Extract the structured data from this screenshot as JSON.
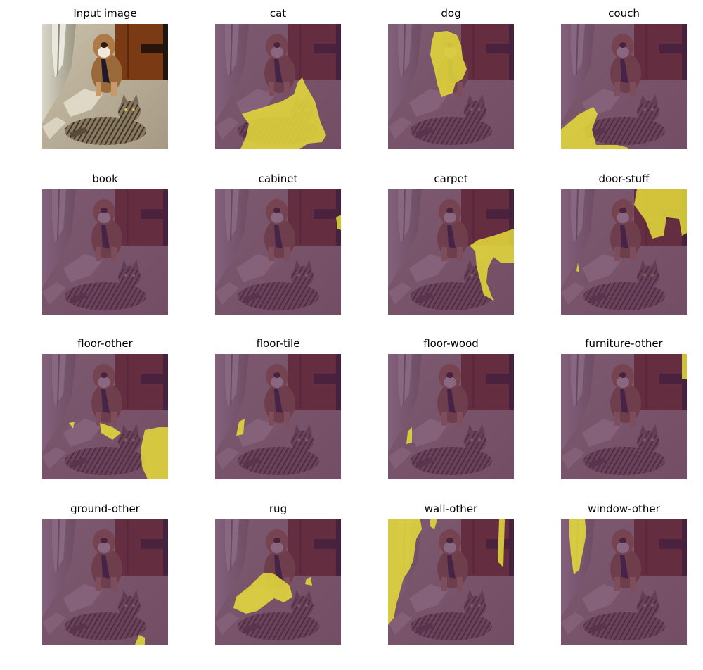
{
  "figure": {
    "panels": [
      {
        "title": "Input image",
        "overlay": false,
        "mask": "none"
      },
      {
        "title": "cat",
        "overlay": true,
        "mask": "cat"
      },
      {
        "title": "dog",
        "overlay": true,
        "mask": "dog"
      },
      {
        "title": "couch",
        "overlay": true,
        "mask": "couch"
      },
      {
        "title": "book",
        "overlay": true,
        "mask": "none"
      },
      {
        "title": "cabinet",
        "overlay": true,
        "mask": "cabinet"
      },
      {
        "title": "carpet",
        "overlay": true,
        "mask": "carpet"
      },
      {
        "title": "door-stuff",
        "overlay": true,
        "mask": "door"
      },
      {
        "title": "floor-other",
        "overlay": true,
        "mask": "floor-other"
      },
      {
        "title": "floor-tile",
        "overlay": true,
        "mask": "floor-tile"
      },
      {
        "title": "floor-wood",
        "overlay": true,
        "mask": "floor-wood"
      },
      {
        "title": "furniture-other",
        "overlay": true,
        "mask": "furniture"
      },
      {
        "title": "ground-other",
        "overlay": true,
        "mask": "ground"
      },
      {
        "title": "rug",
        "overlay": true,
        "mask": "rug"
      },
      {
        "title": "wall-other",
        "overlay": true,
        "mask": "wall"
      },
      {
        "title": "window-other",
        "overlay": true,
        "mask": "window"
      }
    ],
    "colors": {
      "overlay_background": "#5a2a56",
      "mask_highlight": "#e6dd3a"
    }
  }
}
